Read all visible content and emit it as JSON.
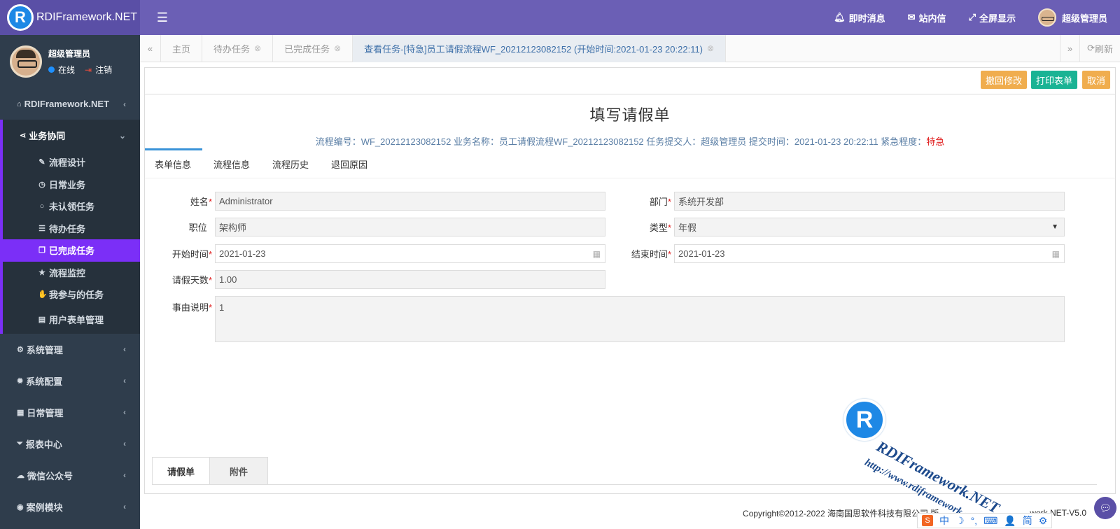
{
  "brand": {
    "logo_letter": "R",
    "name": "RDIFramework.NET"
  },
  "header": {
    "menu_icon": "☰",
    "messages_label": "即时消息",
    "mail_label": "站内信",
    "fullscreen_label": "全屏显示",
    "user_label": "超级管理员",
    "bg_color": "#6b5fb5"
  },
  "sidebar": {
    "user": {
      "name": "超级管理员",
      "status": "在线",
      "logout": "注销"
    },
    "top_items": [
      {
        "label": "RDIFramework.NET",
        "icon": "home-icon"
      }
    ],
    "group": {
      "label": "业务协同",
      "icon": "share-icon",
      "items": [
        {
          "label": "流程设计",
          "icon": "edit-icon",
          "glyph": "✎"
        },
        {
          "label": "日常业务",
          "icon": "clock-icon",
          "glyph": "◷"
        },
        {
          "label": "未认领任务",
          "icon": "circle-icon",
          "glyph": "○"
        },
        {
          "label": "待办任务",
          "icon": "list-icon",
          "glyph": "☰"
        },
        {
          "label": "已完成任务",
          "icon": "copy-icon",
          "glyph": "❐",
          "active": true
        },
        {
          "label": "流程监控",
          "icon": "star-icon",
          "glyph": "★"
        },
        {
          "label": "我参与的任务",
          "icon": "hand-icon",
          "glyph": "✋"
        },
        {
          "label": "用户表单管理",
          "icon": "table-icon",
          "glyph": "▤"
        }
      ]
    },
    "bottom_items": [
      {
        "label": "系统管理",
        "icon": "cogs-icon",
        "glyph": "⚙"
      },
      {
        "label": "系统配置",
        "icon": "gear-icon",
        "glyph": "✹"
      },
      {
        "label": "日常管理",
        "icon": "calendar-icon",
        "glyph": "▦"
      },
      {
        "label": "报表中心",
        "icon": "filter-icon",
        "glyph": "⏷"
      },
      {
        "label": "微信公众号",
        "icon": "wechat-icon",
        "glyph": "☁"
      },
      {
        "label": "案例模块",
        "icon": "eye-icon",
        "glyph": "◉"
      }
    ],
    "accent_color": "#7b2ff7"
  },
  "tabs": {
    "items": [
      {
        "label": "主页",
        "closable": false
      },
      {
        "label": "待办任务",
        "closable": true
      },
      {
        "label": "已完成任务",
        "closable": true
      },
      {
        "label": "查看任务-[特急]员工请假流程WF_20212123082152 (开始时间:2021-01-23 20:22:11)",
        "closable": true,
        "active": true
      }
    ],
    "refresh_label": "刷新"
  },
  "toolbar": {
    "withdraw_label": "撤回修改",
    "print_label": "打印表单",
    "cancel_label": "取消"
  },
  "form": {
    "title": "填写请假单",
    "info_prefix": "流程编号：WF_20212123082152 业务名称：员工请假流程WF_20212123082152 任务提交人：超级管理员 提交时间：2021-01-23 20:22:11 紧急程度：",
    "urgency": "特急",
    "tabs": [
      "表单信息",
      "流程信息",
      "流程历史",
      "退回原因"
    ],
    "fields": {
      "name": {
        "label": "姓名",
        "value": "Administrator",
        "required": true
      },
      "dept": {
        "label": "部门",
        "value": "系统开发部",
        "required": true
      },
      "position": {
        "label": "职位",
        "value": "架构师",
        "required": false
      },
      "type": {
        "label": "类型",
        "value": "年假",
        "required": true
      },
      "start": {
        "label": "开始时间",
        "value": "2021-01-23",
        "required": true
      },
      "end": {
        "label": "结束时间",
        "value": "2021-01-23",
        "required": true
      },
      "days": {
        "label": "请假天数",
        "value": "1.00",
        "required": true
      },
      "reason": {
        "label": "事由说明",
        "value": "1",
        "required": true
      }
    },
    "required_mark": "*"
  },
  "bottom_tabs": [
    "请假单",
    "附件"
  ],
  "footer": {
    "copyright": "Copyright©2012-2022 海南国思软件科技有限公司 版",
    "version_suffix": "work.NET-V5.0"
  },
  "watermark": {
    "logo_letter": "R",
    "text": "RDIFramework.NET",
    "url": "http://www.rdiframework.net"
  },
  "ime": {
    "items": [
      "中",
      "☽",
      "°,",
      "⌨",
      "👤",
      "简",
      "⚙"
    ]
  }
}
